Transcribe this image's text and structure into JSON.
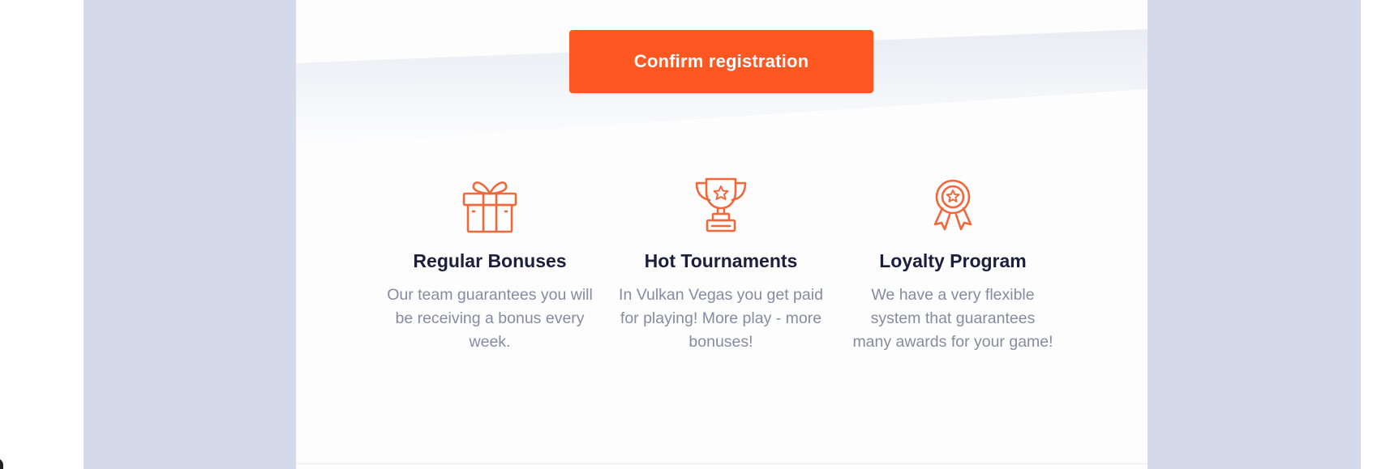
{
  "cta": {
    "label": "Confirm registration"
  },
  "features": [
    {
      "icon": "gift-icon",
      "title": "Regular Bonuses",
      "description": "Our team guarantees you will be receiving a bonus every week."
    },
    {
      "icon": "trophy-icon",
      "title": "Hot Tournaments",
      "description": "In Vulkan Vegas you get paid for playing! More play - more bonuses!"
    },
    {
      "icon": "award-badge-icon",
      "title": "Loyalty Program",
      "description": "We have a very flexible system that guarantees many awards for your game!"
    }
  ],
  "colors": {
    "accent": "#ff5722",
    "icon_stroke": "#f2673a",
    "heading": "#1b1f3b",
    "body_text": "#858ca0",
    "backdrop": "#d4daea",
    "card": "#fdfdfe"
  }
}
